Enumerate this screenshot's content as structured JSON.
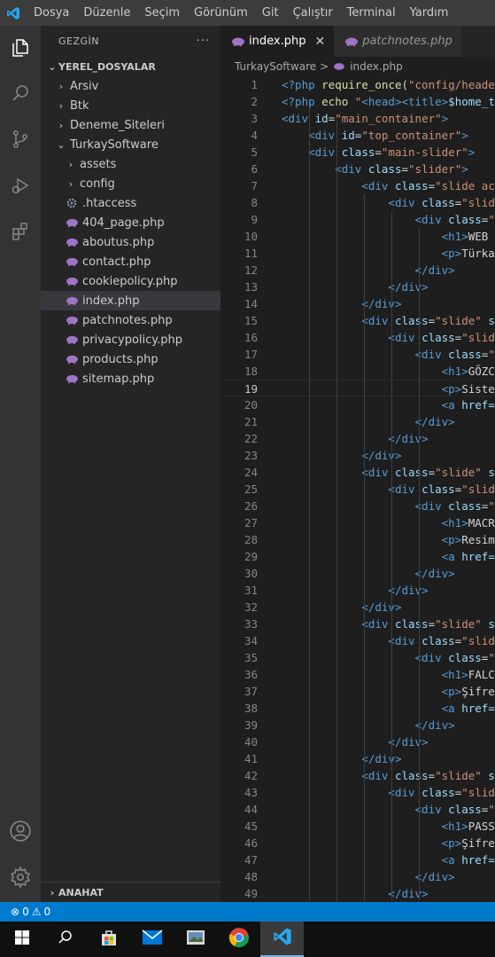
{
  "menu": [
    "Dosya",
    "Düzenle",
    "Seçim",
    "Görünüm",
    "Git",
    "Çalıştır",
    "Terminal",
    "Yardım"
  ],
  "activity_bar": [
    "explorer-icon",
    "search-icon",
    "source-control-icon",
    "run-debug-icon",
    "extensions-icon",
    "account-icon",
    "settings-gear-icon"
  ],
  "explorer": {
    "title": "GEZGİN",
    "more": "···",
    "workspace": "YEREL_DOSYALAR",
    "items": [
      {
        "label": "Arsiv",
        "type": "folder",
        "expanded": false,
        "depth": 1
      },
      {
        "label": "Btk",
        "type": "folder",
        "expanded": false,
        "depth": 1
      },
      {
        "label": "Deneme_Siteleri",
        "type": "folder",
        "expanded": false,
        "depth": 1
      },
      {
        "label": "TurkaySoftware",
        "type": "folder",
        "expanded": true,
        "depth": 1
      },
      {
        "label": "assets",
        "type": "folder",
        "expanded": false,
        "depth": 2
      },
      {
        "label": "config",
        "type": "folder",
        "expanded": false,
        "depth": 2
      },
      {
        "label": ".htaccess",
        "type": "gear",
        "depth": 2
      },
      {
        "label": "404_page.php",
        "type": "php",
        "depth": 2
      },
      {
        "label": "aboutus.php",
        "type": "php",
        "depth": 2
      },
      {
        "label": "contact.php",
        "type": "php",
        "depth": 2
      },
      {
        "label": "cookiepolicy.php",
        "type": "php",
        "depth": 2
      },
      {
        "label": "index.php",
        "type": "php",
        "depth": 2,
        "selected": true
      },
      {
        "label": "patchnotes.php",
        "type": "php",
        "depth": 2
      },
      {
        "label": "privacypolicy.php",
        "type": "php",
        "depth": 2
      },
      {
        "label": "products.php",
        "type": "php",
        "depth": 2
      },
      {
        "label": "sitemap.php",
        "type": "php",
        "depth": 2
      }
    ],
    "outline_label": "ANAHAT"
  },
  "tabs": [
    {
      "label": "index.php",
      "active": true,
      "close": "✕"
    },
    {
      "label": "patchnotes.php",
      "active": false
    }
  ],
  "breadcrumbs": {
    "folder": "TurkaySoftware",
    "sep": ">",
    "file": "index.php"
  },
  "editor": {
    "current_line": 19,
    "lines": [
      [
        [
          "kw",
          "<?php "
        ],
        [
          "fn",
          "require_once"
        ],
        [
          "p",
          "("
        ],
        [
          "s",
          "\"config/heade"
        ]
      ],
      [
        [
          "kw",
          "<?php "
        ],
        [
          "fn",
          "echo "
        ],
        [
          "s",
          "\""
        ],
        [
          "tag",
          "<head><title>"
        ],
        [
          "var",
          "$home_t"
        ]
      ],
      [
        [
          "tag",
          "<div "
        ],
        [
          "attr",
          "id"
        ],
        [
          "p",
          "="
        ],
        [
          "s",
          "\"main_container\""
        ],
        [
          "tag",
          ">"
        ]
      ],
      [
        [
          "p",
          "    "
        ],
        [
          "tag",
          "<div "
        ],
        [
          "attr",
          "id"
        ],
        [
          "p",
          "="
        ],
        [
          "s",
          "\"top_container\""
        ],
        [
          "tag",
          ">"
        ]
      ],
      [
        [
          "p",
          "    "
        ],
        [
          "tag",
          "<div "
        ],
        [
          "attr",
          "class"
        ],
        [
          "p",
          "="
        ],
        [
          "s",
          "\"main-slider\""
        ],
        [
          "tag",
          ">"
        ]
      ],
      [
        [
          "p",
          "        "
        ],
        [
          "tag",
          "<div "
        ],
        [
          "attr",
          "class"
        ],
        [
          "p",
          "="
        ],
        [
          "s",
          "\"slider\""
        ],
        [
          "tag",
          ">"
        ]
      ],
      [
        [
          "p",
          "            "
        ],
        [
          "tag",
          "<div "
        ],
        [
          "attr",
          "class"
        ],
        [
          "p",
          "="
        ],
        [
          "s",
          "\"slide ac"
        ]
      ],
      [
        [
          "p",
          "                "
        ],
        [
          "tag",
          "<div "
        ],
        [
          "attr",
          "class"
        ],
        [
          "p",
          "="
        ],
        [
          "s",
          "\"slid"
        ]
      ],
      [
        [
          "p",
          "                    "
        ],
        [
          "tag",
          "<div "
        ],
        [
          "attr",
          "class"
        ],
        [
          "p",
          "="
        ],
        [
          "s",
          "\""
        ]
      ],
      [
        [
          "p",
          "                        "
        ],
        [
          "tag",
          "<h1>"
        ],
        [
          "t",
          "WEB "
        ]
      ],
      [
        [
          "p",
          "                        "
        ],
        [
          "tag",
          "<p>"
        ],
        [
          "t",
          "Türka"
        ]
      ],
      [
        [
          "p",
          "                    "
        ],
        [
          "tag",
          "</div>"
        ]
      ],
      [
        [
          "p",
          "                "
        ],
        [
          "tag",
          "</div>"
        ]
      ],
      [
        [
          "p",
          "            "
        ],
        [
          "tag",
          "</div>"
        ]
      ],
      [
        [
          "p",
          "            "
        ],
        [
          "tag",
          "<div "
        ],
        [
          "attr",
          "class"
        ],
        [
          "p",
          "="
        ],
        [
          "s",
          "\"slide\" "
        ],
        [
          "attr",
          "s"
        ]
      ],
      [
        [
          "p",
          "                "
        ],
        [
          "tag",
          "<div "
        ],
        [
          "attr",
          "class"
        ],
        [
          "p",
          "="
        ],
        [
          "s",
          "\"slid"
        ]
      ],
      [
        [
          "p",
          "                    "
        ],
        [
          "tag",
          "<div "
        ],
        [
          "attr",
          "class"
        ],
        [
          "p",
          "="
        ],
        [
          "s",
          "\""
        ]
      ],
      [
        [
          "p",
          "                        "
        ],
        [
          "tag",
          "<h1>"
        ],
        [
          "t",
          "GÖZC"
        ]
      ],
      [
        [
          "p",
          "                        "
        ],
        [
          "tag",
          "<p>"
        ],
        [
          "t",
          "Siste"
        ]
      ],
      [
        [
          "p",
          "                        "
        ],
        [
          "tag",
          "<a "
        ],
        [
          "attr",
          "href="
        ]
      ],
      [
        [
          "p",
          "                    "
        ],
        [
          "tag",
          "</div>"
        ]
      ],
      [
        [
          "p",
          "                "
        ],
        [
          "tag",
          "</div>"
        ]
      ],
      [
        [
          "p",
          "            "
        ],
        [
          "tag",
          "</div>"
        ]
      ],
      [
        [
          "p",
          "            "
        ],
        [
          "tag",
          "<div "
        ],
        [
          "attr",
          "class"
        ],
        [
          "p",
          "="
        ],
        [
          "s",
          "\"slide\" "
        ],
        [
          "attr",
          "s"
        ]
      ],
      [
        [
          "p",
          "                "
        ],
        [
          "tag",
          "<div "
        ],
        [
          "attr",
          "class"
        ],
        [
          "p",
          "="
        ],
        [
          "s",
          "\"slid"
        ]
      ],
      [
        [
          "p",
          "                    "
        ],
        [
          "tag",
          "<div "
        ],
        [
          "attr",
          "class"
        ],
        [
          "p",
          "="
        ],
        [
          "s",
          "\""
        ]
      ],
      [
        [
          "p",
          "                        "
        ],
        [
          "tag",
          "<h1>"
        ],
        [
          "t",
          "MACR"
        ]
      ],
      [
        [
          "p",
          "                        "
        ],
        [
          "tag",
          "<p>"
        ],
        [
          "t",
          "Resim"
        ]
      ],
      [
        [
          "p",
          "                        "
        ],
        [
          "tag",
          "<a "
        ],
        [
          "attr",
          "href="
        ]
      ],
      [
        [
          "p",
          "                    "
        ],
        [
          "tag",
          "</div>"
        ]
      ],
      [
        [
          "p",
          "                "
        ],
        [
          "tag",
          "</div>"
        ]
      ],
      [
        [
          "p",
          "            "
        ],
        [
          "tag",
          "</div>"
        ]
      ],
      [
        [
          "p",
          "            "
        ],
        [
          "tag",
          "<div "
        ],
        [
          "attr",
          "class"
        ],
        [
          "p",
          "="
        ],
        [
          "s",
          "\"slide\" "
        ],
        [
          "attr",
          "s"
        ]
      ],
      [
        [
          "p",
          "                "
        ],
        [
          "tag",
          "<div "
        ],
        [
          "attr",
          "class"
        ],
        [
          "p",
          "="
        ],
        [
          "s",
          "\"slid"
        ]
      ],
      [
        [
          "p",
          "                    "
        ],
        [
          "tag",
          "<div "
        ],
        [
          "attr",
          "class"
        ],
        [
          "p",
          "="
        ],
        [
          "s",
          "\""
        ]
      ],
      [
        [
          "p",
          "                        "
        ],
        [
          "tag",
          "<h1>"
        ],
        [
          "t",
          "FALC"
        ]
      ],
      [
        [
          "p",
          "                        "
        ],
        [
          "tag",
          "<p>"
        ],
        [
          "t",
          "Şifre"
        ]
      ],
      [
        [
          "p",
          "                        "
        ],
        [
          "tag",
          "<a "
        ],
        [
          "attr",
          "href="
        ]
      ],
      [
        [
          "p",
          "                    "
        ],
        [
          "tag",
          "</div>"
        ]
      ],
      [
        [
          "p",
          "                "
        ],
        [
          "tag",
          "</div>"
        ]
      ],
      [
        [
          "p",
          "            "
        ],
        [
          "tag",
          "</div>"
        ]
      ],
      [
        [
          "p",
          "            "
        ],
        [
          "tag",
          "<div "
        ],
        [
          "attr",
          "class"
        ],
        [
          "p",
          "="
        ],
        [
          "s",
          "\"slide\" "
        ],
        [
          "attr",
          "s"
        ]
      ],
      [
        [
          "p",
          "                "
        ],
        [
          "tag",
          "<div "
        ],
        [
          "attr",
          "class"
        ],
        [
          "p",
          "="
        ],
        [
          "s",
          "\"slid"
        ]
      ],
      [
        [
          "p",
          "                    "
        ],
        [
          "tag",
          "<div "
        ],
        [
          "attr",
          "class"
        ],
        [
          "p",
          "="
        ],
        [
          "s",
          "\""
        ]
      ],
      [
        [
          "p",
          "                        "
        ],
        [
          "tag",
          "<h1>"
        ],
        [
          "t",
          "PASS"
        ]
      ],
      [
        [
          "p",
          "                        "
        ],
        [
          "tag",
          "<p>"
        ],
        [
          "t",
          "Şifre"
        ]
      ],
      [
        [
          "p",
          "                        "
        ],
        [
          "tag",
          "<a "
        ],
        [
          "attr",
          "href="
        ]
      ],
      [
        [
          "p",
          "                    "
        ],
        [
          "tag",
          "</div>"
        ]
      ],
      [
        [
          "p",
          "                "
        ],
        [
          "tag",
          "</div>"
        ]
      ]
    ]
  },
  "status": {
    "errors": "0",
    "warnings": "0"
  },
  "taskbar": [
    {
      "name": "start-button",
      "icon": "windows-logo-icon"
    },
    {
      "name": "taskbar-search-button",
      "icon": "search-icon"
    },
    {
      "name": "taskbar-store-button",
      "icon": "store-bag-icon"
    },
    {
      "name": "taskbar-mail-button",
      "icon": "mail-icon"
    },
    {
      "name": "taskbar-photos-button",
      "icon": "photos-icon"
    },
    {
      "name": "taskbar-chrome-button",
      "icon": "chrome-icon"
    },
    {
      "name": "taskbar-vscode-button",
      "icon": "vscode-icon",
      "active": true
    }
  ],
  "colors": {
    "kw": "#569cd6",
    "fn": "#dcdcaa",
    "s": "#ce9178",
    "tag": "#569cd6",
    "attr": "#9cdcfe",
    "var": "#9cdcfe",
    "t": "#d4d4d4",
    "p": "#d4d4d4",
    "accent": "#007acc",
    "php_icon": "#a074c4"
  }
}
